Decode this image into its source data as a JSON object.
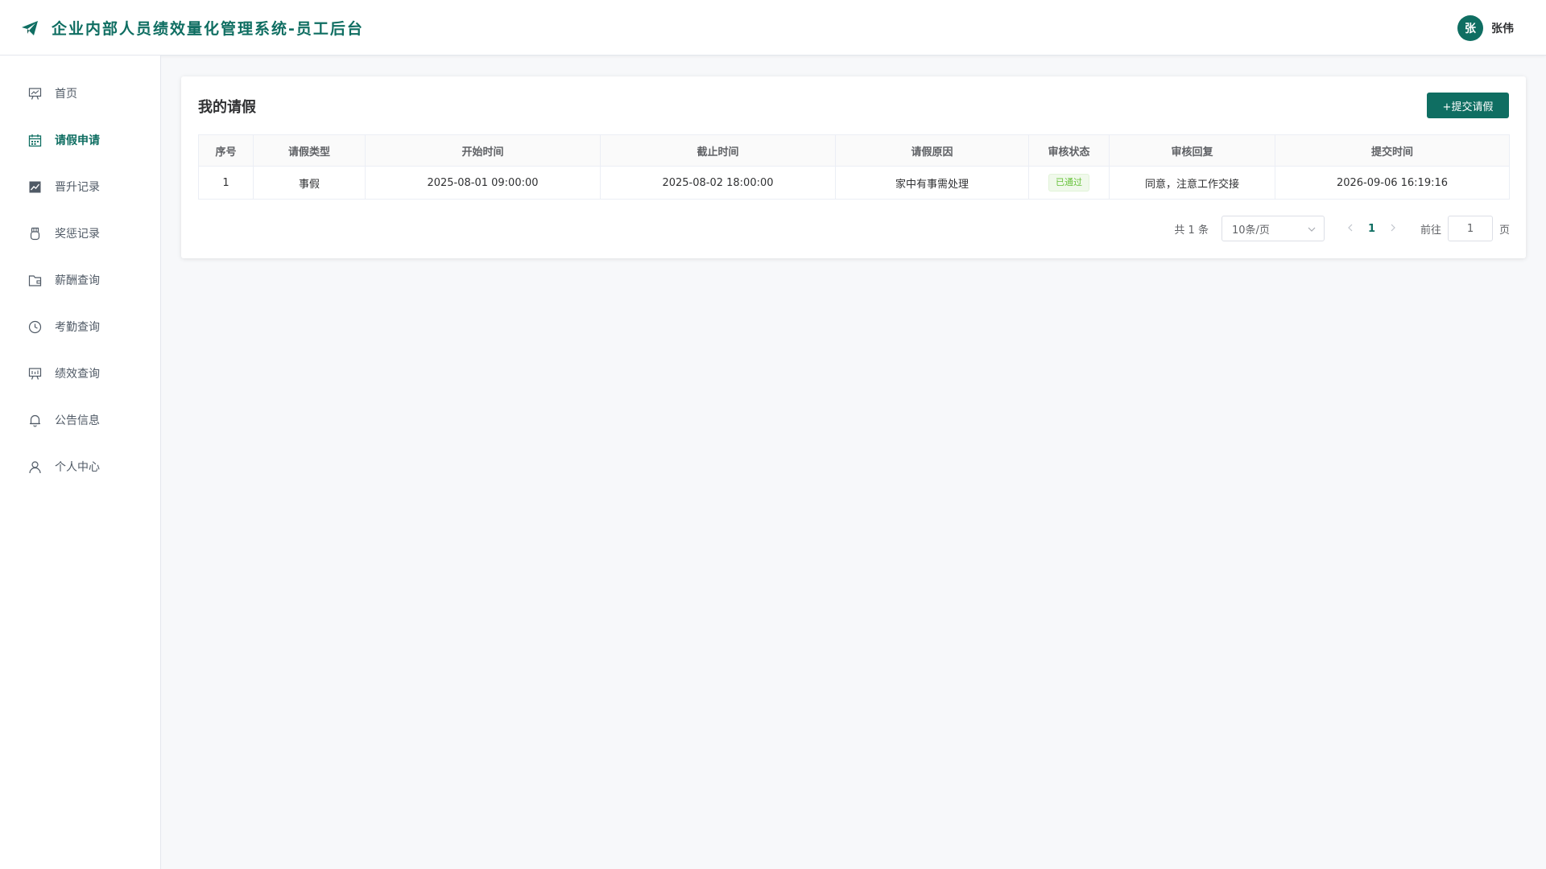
{
  "header": {
    "app_title": "企业内部人员绩效量化管理系统-员工后台",
    "avatar_text": "张",
    "username": "张伟"
  },
  "sidebar": {
    "items": [
      {
        "label": "首页",
        "icon": "presentation-icon"
      },
      {
        "label": "请假申请",
        "icon": "calendar-icon",
        "active": true
      },
      {
        "label": "晋升记录",
        "icon": "trend-chart-icon"
      },
      {
        "label": "奖惩记录",
        "icon": "medal-icon"
      },
      {
        "label": "薪酬查询",
        "icon": "wallet-icon"
      },
      {
        "label": "考勤查询",
        "icon": "clock-icon"
      },
      {
        "label": "绩效查询",
        "icon": "data-board-icon"
      },
      {
        "label": "公告信息",
        "icon": "bell-icon"
      },
      {
        "label": "个人中心",
        "icon": "user-icon"
      }
    ]
  },
  "main": {
    "card_title": "我的请假",
    "submit_label": "+提交请假",
    "columns": [
      "序号",
      "请假类型",
      "开始时间",
      "截止时间",
      "请假原因",
      "审核状态",
      "审核回复",
      "提交时间"
    ],
    "rows": [
      {
        "index": "1",
        "type": "事假",
        "start": "2025-08-01 09:00:00",
        "end": "2025-08-02 18:00:00",
        "reason": "家中有事需处理",
        "status": "已通过",
        "reply": "同意，注意工作交接",
        "submitted": "2026-09-06 16:19:16"
      }
    ],
    "pagination": {
      "total_text": "共 1 条",
      "page_size": "10条/页",
      "current_page": "1",
      "goto_label": "前往",
      "goto_value": "1",
      "page_suffix": "页"
    }
  },
  "colors": {
    "brand": "#0f6e62",
    "success": "#67c23a"
  }
}
